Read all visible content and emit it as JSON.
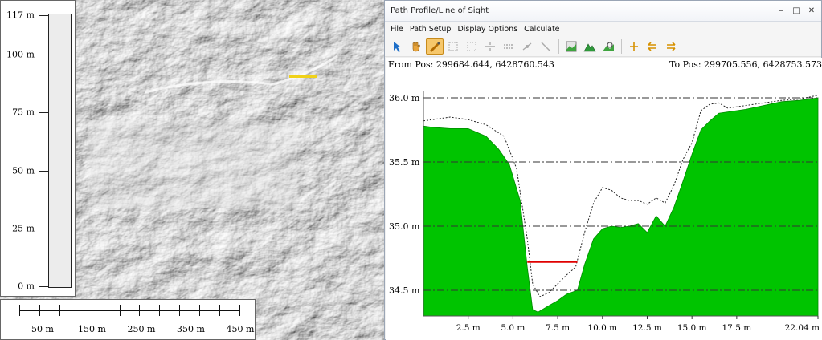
{
  "map": {
    "vertical_scale": {
      "labels": [
        "117 m",
        "100 m",
        "75 m",
        "50 m",
        "25 m",
        "0 m"
      ],
      "values": [
        117,
        100,
        75,
        50,
        25,
        0
      ],
      "max": 117
    },
    "horizontal_scale": {
      "labels": [
        "50 m",
        "150 m",
        "250 m",
        "350 m",
        "450 m"
      ]
    }
  },
  "window": {
    "title": "Path Profile/Line of Sight",
    "controls": {
      "minimize": "–",
      "maximize": "□",
      "close": "✕"
    },
    "menu": [
      "File",
      "Path Setup",
      "Display Options",
      "Calculate"
    ],
    "toolbar_icons": [
      "path-select-icon",
      "hand-pan-icon",
      "draw-path-icon",
      "grid-points-icon",
      "grid-dots-icon",
      "split-icon",
      "align-icon",
      "node-icon",
      "line-icon",
      "terrain-profile-icon",
      "mountain-icon",
      "zoom-terrain-icon",
      "path-vertical-icon",
      "path-back-icon",
      "path-forward-icon"
    ],
    "from_pos": "From Pos: 299684.644, 6428760.543",
    "to_pos": "To Pos: 299705.556, 6428753.573"
  },
  "chart_data": {
    "type": "area",
    "colors": {
      "terrain": "#00c400",
      "line_of_sight": "#e00000",
      "surface": "#222222",
      "grid": "#333333"
    },
    "y_ticks": [
      "36.0 m",
      "35.5 m",
      "35.0 m",
      "34.5 m"
    ],
    "y_tick_values": [
      36.0,
      35.5,
      35.0,
      34.5
    ],
    "x_ticks": [
      "2.5 m",
      "5.0 m",
      "7.5 m",
      "10.0 m",
      "12.5 m",
      "15.0 m",
      "17.5 m",
      "22.04 m"
    ],
    "x_tick_values": [
      2.5,
      5.0,
      7.5,
      10.0,
      12.5,
      15.0,
      17.5,
      22.04
    ],
    "xlim": [
      0,
      22.04
    ],
    "ylim": [
      34.3,
      36.0
    ],
    "series": [
      {
        "x": [
          0,
          0.5,
          1.5,
          2.5,
          3.5,
          4.2,
          4.8,
          5.4,
          5.8,
          6.1,
          6.4,
          7.0,
          7.5,
          8.0,
          8.6,
          9.0,
          9.5,
          10.0,
          10.5,
          11.0,
          11.5,
          12.0,
          12.5,
          13.0,
          13.5,
          14.0,
          14.5,
          15.0,
          15.5,
          16.0,
          16.5,
          17.0,
          18.0,
          19.0,
          20.0,
          21.0,
          22.04
        ],
        "y": [
          35.78,
          35.77,
          35.76,
          35.76,
          35.7,
          35.6,
          35.48,
          35.2,
          34.68,
          34.35,
          34.33,
          34.38,
          34.42,
          34.47,
          34.5,
          34.7,
          34.9,
          34.98,
          35.0,
          34.99,
          35.0,
          35.02,
          34.95,
          35.08,
          35.0,
          35.15,
          35.35,
          35.56,
          35.75,
          35.82,
          35.88,
          35.89,
          35.91,
          35.94,
          35.97,
          35.98,
          36.0
        ]
      },
      {
        "x": [
          0,
          1.5,
          2.5,
          3.5,
          4.5,
          5.2,
          5.8,
          6.1,
          6.5,
          7.0,
          7.5,
          8.0,
          8.5,
          9.0,
          9.5,
          10.0,
          10.5,
          11.0,
          11.5,
          12.0,
          12.5,
          13.0,
          13.5,
          14.0,
          14.5,
          15.0,
          15.5,
          16.0,
          16.5,
          17.0,
          18.0,
          19.0,
          20.0,
          21.0,
          22.04
        ],
        "y": [
          35.82,
          35.85,
          35.83,
          35.79,
          35.7,
          35.45,
          34.9,
          34.55,
          34.45,
          34.48,
          34.55,
          34.62,
          34.68,
          34.95,
          35.18,
          35.3,
          35.28,
          35.22,
          35.2,
          35.2,
          35.17,
          35.22,
          35.18,
          35.32,
          35.52,
          35.65,
          35.9,
          35.95,
          35.96,
          35.92,
          35.94,
          35.96,
          35.98,
          35.99,
          36.02
        ]
      },
      {
        "x": [
          5.8,
          8.6
        ],
        "y": [
          34.72,
          34.72
        ]
      }
    ]
  }
}
